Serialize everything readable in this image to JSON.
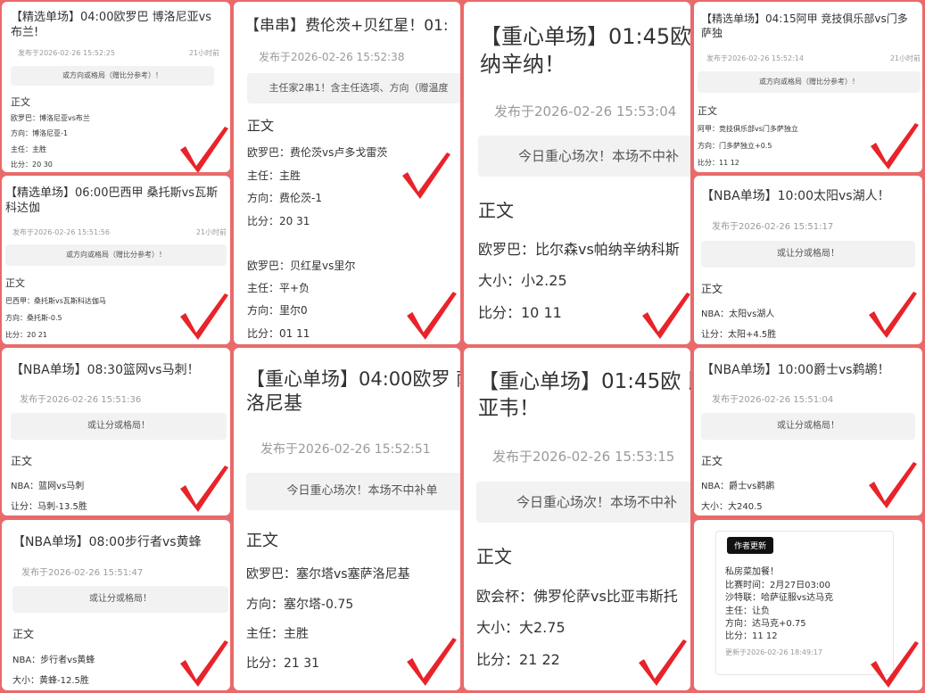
{
  "cards": [
    {
      "title": "【精选单场】04:00欧罗巴 博洛尼亚vs布兰!",
      "published": "发布于2026-02-26 15:52:25",
      "ago": "21小时前",
      "bar": "或方向或格局（赠比分参考）！",
      "section": "正文",
      "lines": [
        "欧罗巴：博洛尼亚vs布兰",
        "方向：博洛尼亚-1",
        "主任：主胜",
        "比分：20 30"
      ]
    },
    {
      "title": "【串串】费伦茨+贝红星！01:",
      "published": "发布于2026-02-26 15:52:38",
      "bar": "主任家2串1！含主任选项、方向（赠温度",
      "section": "正文",
      "lines": [
        "欧罗巴：费伦茨vs卢多戈雷茨",
        "主任：主胜",
        "方向：费伦茨-1",
        "比分：20 31",
        "欧罗巴：贝红星vs里尔",
        "主任：平+负",
        "方向：里尔0",
        "比分：01 11"
      ]
    },
    {
      "title": "【重心单场】01:45欧 纳辛纳！",
      "published": "发布于2026-02-26 15:53:04",
      "bar": "今日重心场次！本场不中补",
      "section": "正文",
      "lines": [
        "欧罗巴：比尔森vs帕纳辛纳科斯",
        "大小：小2.25",
        "比分：10 11"
      ]
    },
    {
      "title": "【精选单场】04:15阿甲 竞技俱乐部vs门多萨独",
      "published": "发布于2026-02-26 15:52:14",
      "ago": "21小时前",
      "bar": "或方向或格局（赠比分参考）！",
      "section": "正文",
      "lines": [
        "阿甲：竞技俱乐部vs门多萨独立",
        "方向：门多萨独立+0.5",
        "比分：11 12"
      ]
    },
    {
      "title": "【精选单场】06:00巴西甲 桑托斯vs瓦斯科达伽",
      "published": "发布于2026-02-26 15:51:56",
      "ago": "21小时前",
      "bar": "或方向或格局（赠比分参考）！",
      "section": "正文",
      "lines": [
        "巴西甲：桑托斯vs瓦斯科达伽马",
        "方向：桑托斯-0.5",
        "比分：20 21"
      ]
    },
    {
      "title": "【NBA单场】10:00太阳vs湖人！",
      "published": "发布于2026-02-26 15:51:17",
      "bar": "或让分或格局！",
      "section": "正文",
      "lines": [
        "NBA：太阳vs湖人",
        "让分：太阳+4.5胜"
      ]
    },
    {
      "title": "【NBA单场】08:30篮网vs马刺！",
      "published": "发布于2026-02-26 15:51:36",
      "bar": "或让分或格局！",
      "section": "正文",
      "lines": [
        "NBA：篮网vs马刺",
        "让分：马刺-13.5胜"
      ]
    },
    {
      "title": "【重心单场】04:00欧罗 萨洛尼基",
      "published": "发布于2026-02-26 15:52:51",
      "bar": "今日重心场次！本场不中补单",
      "section": "正文",
      "lines": [
        "欧罗巴：塞尔塔vs塞萨洛尼基",
        "方向：塞尔塔-0.75",
        "主任：主胜",
        "比分：21 31"
      ]
    },
    {
      "title": "【重心单场】01:45欧 比亚韦！",
      "published": "发布于2026-02-26 15:53:15",
      "bar": "今日重心场次！本场不中补",
      "section": "正文",
      "lines": [
        "欧会杯：佛罗伦萨vs比亚韦斯托",
        "大小：大2.75",
        "比分：21 22"
      ]
    },
    {
      "title": "【NBA单场】10:00爵士vs鹈鹕！",
      "published": "发布于2026-02-26 15:51:04",
      "bar": "或让分或格局！",
      "section": "正文",
      "lines": [
        "NBA：爵士vs鹈鹕",
        "大小：大240.5"
      ]
    },
    {
      "title": "【NBA单场】08:00步行者vs黄蜂",
      "published": "发布于2026-02-26 15:51:47",
      "bar": "或让分或格局！",
      "section": "正文",
      "lines": [
        "NBA：步行者vs黄蜂",
        "大小：黄蜂-12.5胜"
      ]
    }
  ],
  "author_card": {
    "tag": "作者更新",
    "lines": [
      "私房菜加餐！",
      "比赛时间：2月27日03:00",
      "沙特联：哈萨征服vs达马克",
      "主任：让负",
      "方向：达马克+0.75",
      "比分：11 12"
    ],
    "updated": "更新于2026-02-26 18:49:17"
  },
  "colors": {
    "background": "#e96a6a",
    "check": "#e8232a"
  }
}
